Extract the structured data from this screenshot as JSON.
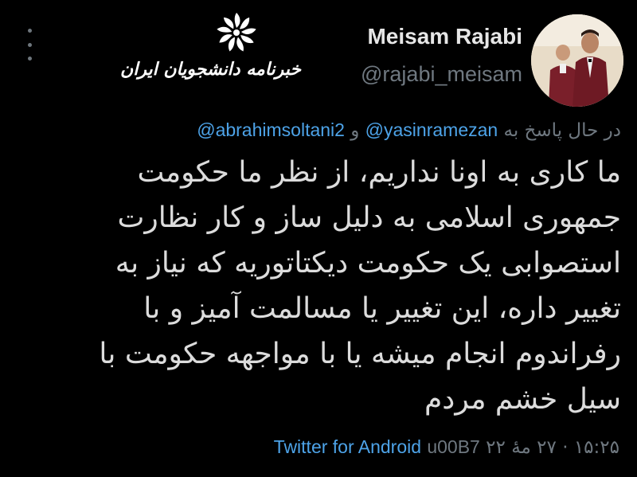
{
  "header": {
    "display_name": "Meisam Rajabi",
    "handle": "@rajabi_meisam",
    "watermark_text": "خبرنامه دانشجویان ایران"
  },
  "reply": {
    "prefix": "در حال پاسخ به",
    "mention_1": "@yasinramezan",
    "conjunction": "و",
    "mention_2": "@abrahimsoltani2"
  },
  "tweet": {
    "lines": [
      "ما کاری به اونا نداریم، از نظر ما حکومت",
      "جمهوری اسلامی به دلیل ساز و کار نظارت",
      "استصوابی یک حکومت دیکتاتوریه که نیاز به",
      "تغییر داره، این تغییر یا مسالمت آمیز و با",
      "رفراندوم انجام میشه یا با مواجهه حکومت با",
      "سیل خشم مردم"
    ]
  },
  "meta": {
    "time": "۱۵:۲۵",
    "date": "۲۷ مهٔ ۲۲",
    "separator": "u00B7",
    "source": "Twitter for Android"
  },
  "colors": {
    "background": "#000000",
    "text": "#dcdcdc",
    "secondary": "#6f7880",
    "link": "#4da3e8"
  },
  "icons": {
    "more": "more-vertical-icon",
    "logo": "iran-students-news-logo-icon"
  }
}
